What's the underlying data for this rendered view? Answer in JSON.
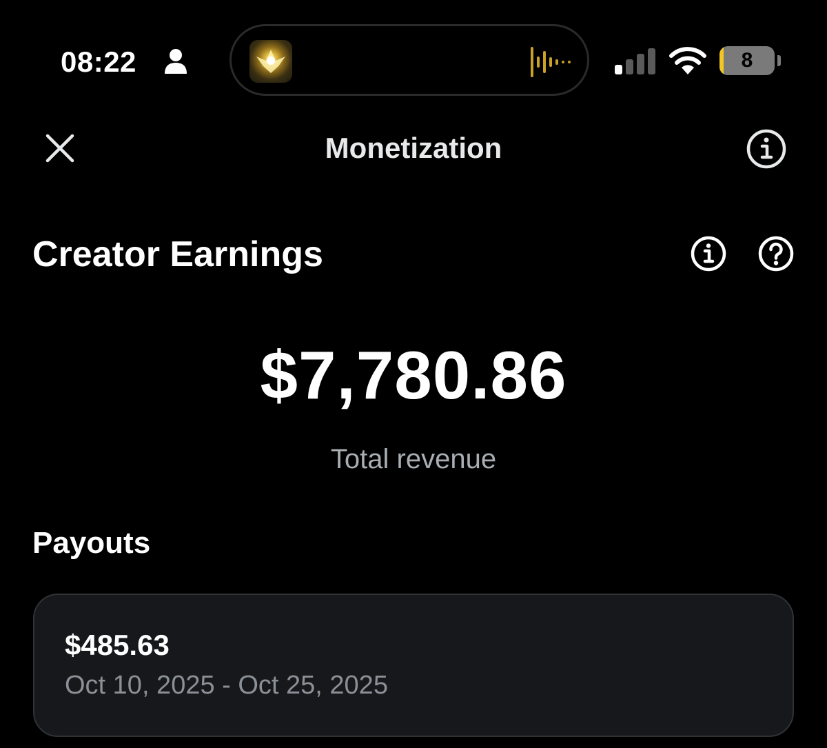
{
  "status_bar": {
    "time": "08:22",
    "battery_level": "8",
    "battery_fill_fraction": 0.08,
    "icons": [
      "person-icon",
      "cellular-signal-icon",
      "wifi-icon",
      "battery-icon"
    ]
  },
  "dynamic_island": {
    "icons": [
      "now-playing-artwork",
      "audio-waveform-icon"
    ],
    "waveform_color": "#c9a227"
  },
  "header": {
    "title": "Monetization",
    "close_icon": "close-icon",
    "info_icon": "info-icon"
  },
  "creator_earnings": {
    "title": "Creator Earnings",
    "total_amount": "$7,780.86",
    "total_label": "Total revenue",
    "icons": [
      "info-icon",
      "help-icon"
    ]
  },
  "payouts": {
    "title": "Payouts",
    "items": [
      {
        "amount": "$485.63",
        "date_range": "Oct 10, 2025 - Oct 25, 2025"
      }
    ]
  },
  "colors": {
    "background": "#000000",
    "card_background": "#16181c",
    "secondary_text": "#a9aeb3",
    "battery_accent": "#f3c623"
  }
}
